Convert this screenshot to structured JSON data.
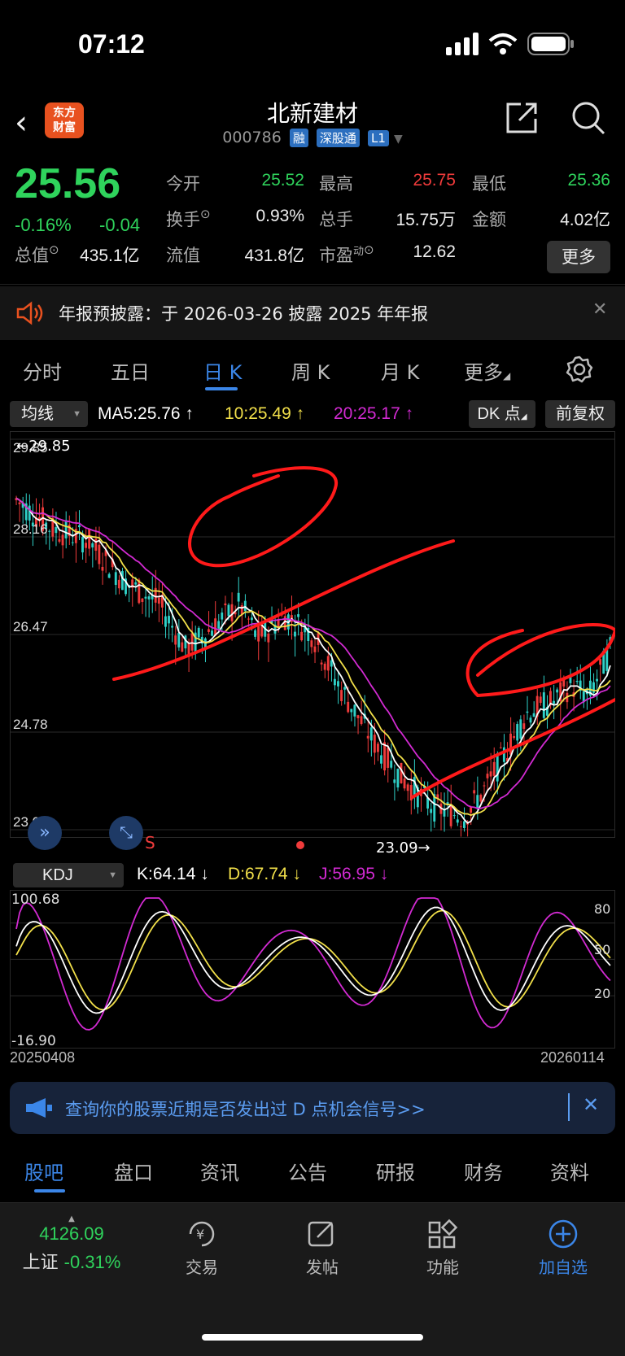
{
  "status": {
    "time": "07:12"
  },
  "header": {
    "logo_line1": "东方",
    "logo_line2": "财富",
    "name": "北新建材",
    "code": "000786",
    "tags": [
      "融",
      "深股通",
      "L1"
    ]
  },
  "quote": {
    "price": "25.56",
    "change_pct": "-0.16%",
    "change": "-0.04",
    "open_label": "今开",
    "open": "25.52",
    "high_label": "最高",
    "high": "25.75",
    "low_label": "最低",
    "low": "25.36",
    "turnover_label": "换手",
    "turnover": "0.93%",
    "volume_label": "总手",
    "volume": "15.75万",
    "amount_label": "金额",
    "amount": "4.02亿",
    "mktcap_label": "总值",
    "mktcap": "435.1亿",
    "float_label": "流值",
    "float": "431.8亿",
    "pe_label": "市盈",
    "pe_sup": "动",
    "pe": "12.62",
    "more_label": "更多"
  },
  "notice": {
    "text": "年报预披露：于 2026-03-26 披露 2025 年年报"
  },
  "period_tabs": [
    "分时",
    "五日",
    "日 K",
    "周 K",
    "月 K",
    "更多"
  ],
  "ma": {
    "selector": "均线",
    "ma5": "MA5:25.76 ↑",
    "ma10": "10:25.49 ↑",
    "ma20": "20:25.17 ↑",
    "dk_label": "DK 点",
    "adjust_label": "前复权"
  },
  "price_axis": [
    "29.85",
    "28.16",
    "26.47",
    "24.78",
    "23.09"
  ],
  "price_marks": {
    "high_mark": "←29.85",
    "low_mark": "23.09→",
    "signal": "S"
  },
  "kdj": {
    "selector": "KDJ",
    "k": "K:64.14 ↓",
    "d": "D:67.74 ↓",
    "j": "J:56.95 ↓",
    "axis_top": "100.68",
    "axis_bottom": "-16.90",
    "right_ticks": [
      "80",
      "50",
      "20"
    ]
  },
  "dates": {
    "start": "20250408",
    "end": "20260114"
  },
  "banner": {
    "text": "查询你的股票近期是否发出过 D 点机会信号>>"
  },
  "bottom_tabs": [
    "股吧",
    "盘口",
    "资讯",
    "公告",
    "研报",
    "财务",
    "资料"
  ],
  "nav": {
    "index_value": "4126.09",
    "index_name": "上证",
    "index_change": "-0.31%",
    "items": [
      "交易",
      "发帖",
      "功能",
      "加自选"
    ]
  },
  "colors": {
    "up": "#f03b3b",
    "down": "#2fd35c",
    "accent": "#3b86e8",
    "ma5": "#ffffff",
    "ma10": "#f2e04a",
    "ma20": "#d22ad2"
  }
}
